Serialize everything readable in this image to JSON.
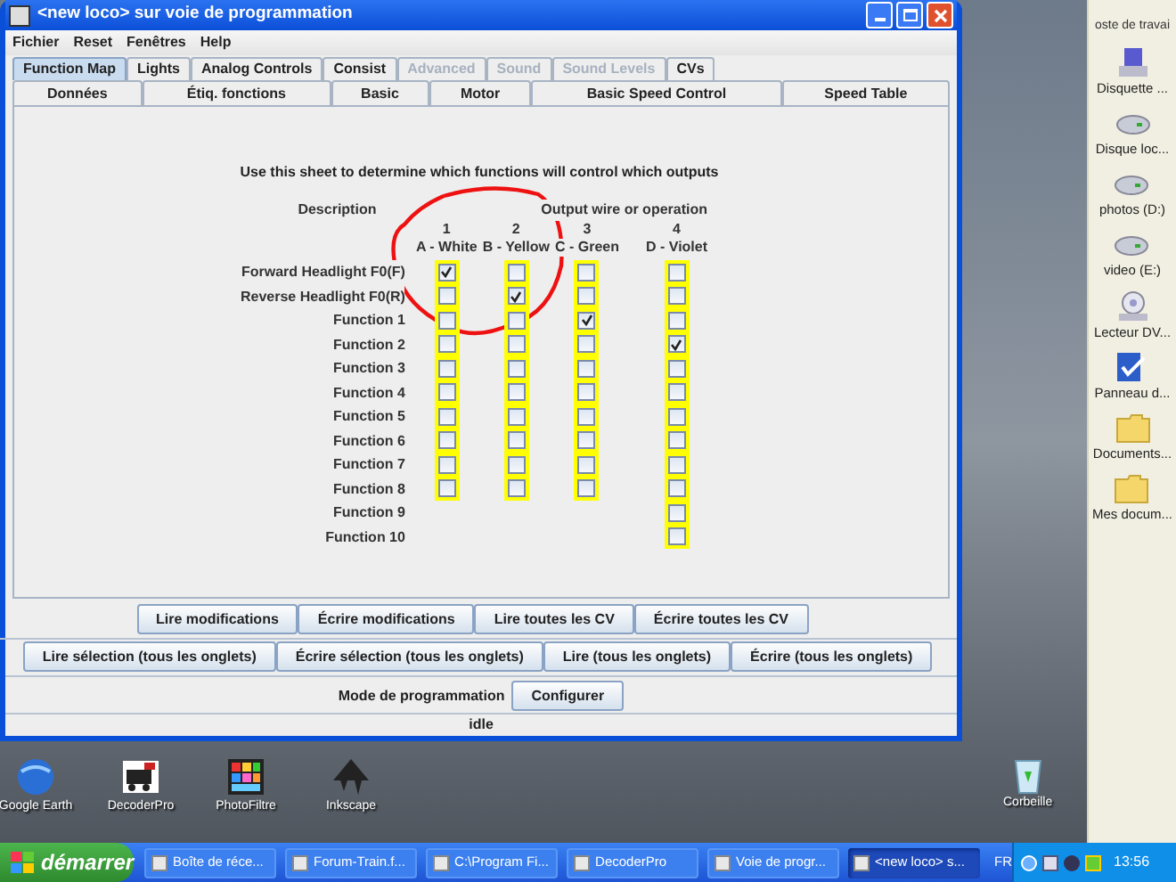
{
  "window": {
    "title": "<new loco> sur voie de programmation"
  },
  "menu": [
    "Fichier",
    "Reset",
    "Fenêtres",
    "Help"
  ],
  "tabs_row1": [
    {
      "label": "Function Map",
      "selected": true,
      "disabled": false
    },
    {
      "label": "Lights",
      "selected": false,
      "disabled": false
    },
    {
      "label": "Analog Controls",
      "selected": false,
      "disabled": false
    },
    {
      "label": "Consist",
      "selected": false,
      "disabled": false
    },
    {
      "label": "Advanced",
      "selected": false,
      "disabled": true
    },
    {
      "label": "Sound",
      "selected": false,
      "disabled": true
    },
    {
      "label": "Sound Levels",
      "selected": false,
      "disabled": true
    },
    {
      "label": "CVs",
      "selected": false,
      "disabled": false
    }
  ],
  "tabs_row2": [
    "Données",
    "Étiq. fonctions",
    "Basic",
    "Motor",
    "Basic Speed Control",
    "Speed Table"
  ],
  "sheet": {
    "instruction": "Use this sheet to determine which functions will control which outputs",
    "description_heading": "Description",
    "output_heading": "Output wire or operation",
    "rows": [
      "Forward Headlight F0(F)",
      "Reverse Headlight F0(R)",
      "Function 1",
      "Function 2",
      "Function 3",
      "Function 4",
      "Function 5",
      "Function 6",
      "Function 7",
      "Function 8",
      "Function 9",
      "Function 10"
    ],
    "outputs": [
      {
        "number": "1",
        "name": "A - White",
        "checks": [
          true,
          false,
          false,
          false,
          false,
          false,
          false,
          false,
          false,
          false
        ]
      },
      {
        "number": "2",
        "name": "B - Yellow",
        "checks": [
          false,
          true,
          false,
          false,
          false,
          false,
          false,
          false,
          false,
          false
        ]
      },
      {
        "number": "3",
        "name": "C - Green",
        "checks": [
          false,
          false,
          true,
          false,
          false,
          false,
          false,
          false,
          false,
          false
        ]
      },
      {
        "number": "4",
        "name": "D - Violet",
        "checks": [
          false,
          false,
          false,
          true,
          false,
          false,
          false,
          false,
          false,
          false,
          false,
          false
        ]
      }
    ]
  },
  "buttons_row1": [
    "Lire modifications",
    "Écrire modifications",
    "Lire toutes les CV",
    "Écrire toutes les CV"
  ],
  "buttons_row2": [
    "Lire sélection (tous les onglets)",
    "Écrire sélection (tous les onglets)",
    "Lire (tous les onglets)",
    "Écrire (tous les onglets)"
  ],
  "programming_mode": {
    "label": "Mode de programmation",
    "button": "Configurer"
  },
  "status": "idle",
  "desktop_icons": [
    "Google Earth",
    "DecoderPro",
    "PhotoFiltre",
    "Inkscape"
  ],
  "recycle_bin": "Corbeille",
  "side_panel": {
    "title": "oste de travai",
    "items": [
      "Disquette ...",
      "Disque loc...",
      "photos (D:)",
      "video (E:)",
      "Lecteur DV...",
      "Panneau d...",
      "Documents...",
      "Mes docum..."
    ]
  },
  "taskbar": {
    "start": "démarrer",
    "tasks": [
      {
        "label": "Boîte de réce...",
        "selected": false
      },
      {
        "label": "Forum-Train.f...",
        "selected": false
      },
      {
        "label": "C:\\Program Fi...",
        "selected": false
      },
      {
        "label": "DecoderPro",
        "selected": false
      },
      {
        "label": "Voie de progr...",
        "selected": false
      },
      {
        "label": "<new loco> s...",
        "selected": true
      }
    ],
    "language": "FR",
    "time": "13:56"
  }
}
